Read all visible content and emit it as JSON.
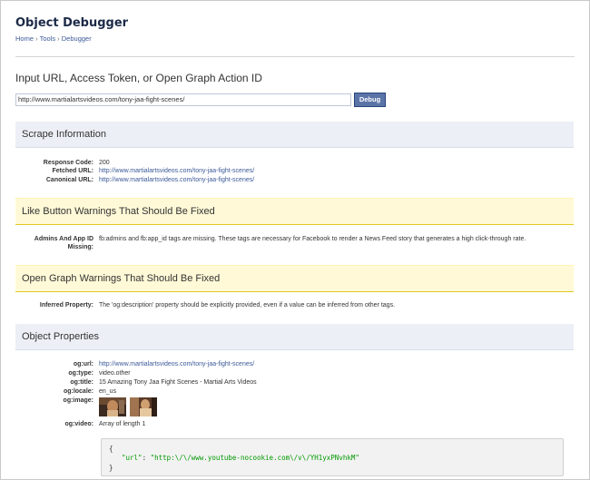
{
  "page": {
    "title": "Object Debugger",
    "breadcrumb": {
      "home": "Home",
      "tools": "Tools",
      "debugger": "Debugger",
      "sep": "›"
    }
  },
  "input": {
    "prompt": "Input URL, Access Token, or Open Graph Action ID",
    "value": "http://www.martialartsvideos.com/tony-jaa-fight-scenes/",
    "button": "Debug"
  },
  "scrape": {
    "heading": "Scrape Information",
    "rows": [
      {
        "label": "Response Code:",
        "value": "200"
      },
      {
        "label": "Fetched URL:",
        "value": "http://www.martialartsvideos.com/tony-jaa-fight-scenes/"
      },
      {
        "label": "Canonical URL:",
        "value": "http://www.martialartsvideos.com/tony-jaa-fight-scenes/"
      }
    ]
  },
  "like_warnings": {
    "heading": "Like Button Warnings That Should Be Fixed",
    "label_line1": "Admins And App ID",
    "label_line2": "Missing:",
    "value": "fb:admins and fb:app_id tags are missing. These tags are necessary for Facebook to render a News Feed story that generates a high click-through rate."
  },
  "og_warnings": {
    "heading": "Open Graph Warnings That Should Be Fixed",
    "label": "Inferred Property:",
    "value": "The 'og:description' property should be explicitly provided, even if a value can be inferred from other tags."
  },
  "properties": {
    "heading": "Object Properties",
    "url_label": "og:url:",
    "url_value": "http://www.martialartsvideos.com/tony-jaa-fight-scenes/",
    "type_label": "og:type:",
    "type_value": "video.other",
    "title_label": "og:title:",
    "title_value": "15 Amazing Tony Jaa Fight Scenes - Martial Arts Videos",
    "locale_label": "og:locale:",
    "locale_value": "en_us",
    "image_label": "og:image:",
    "video_label": "og:video:",
    "video_value": "Array of length 1"
  },
  "code": {
    "open": "{",
    "key": "\"url\"",
    "colon": ": ",
    "value": "\"http:\\/\\/www.youtube-nocookie.com\\/v\\/YH1yxPNvhkM\"",
    "close": "}"
  }
}
